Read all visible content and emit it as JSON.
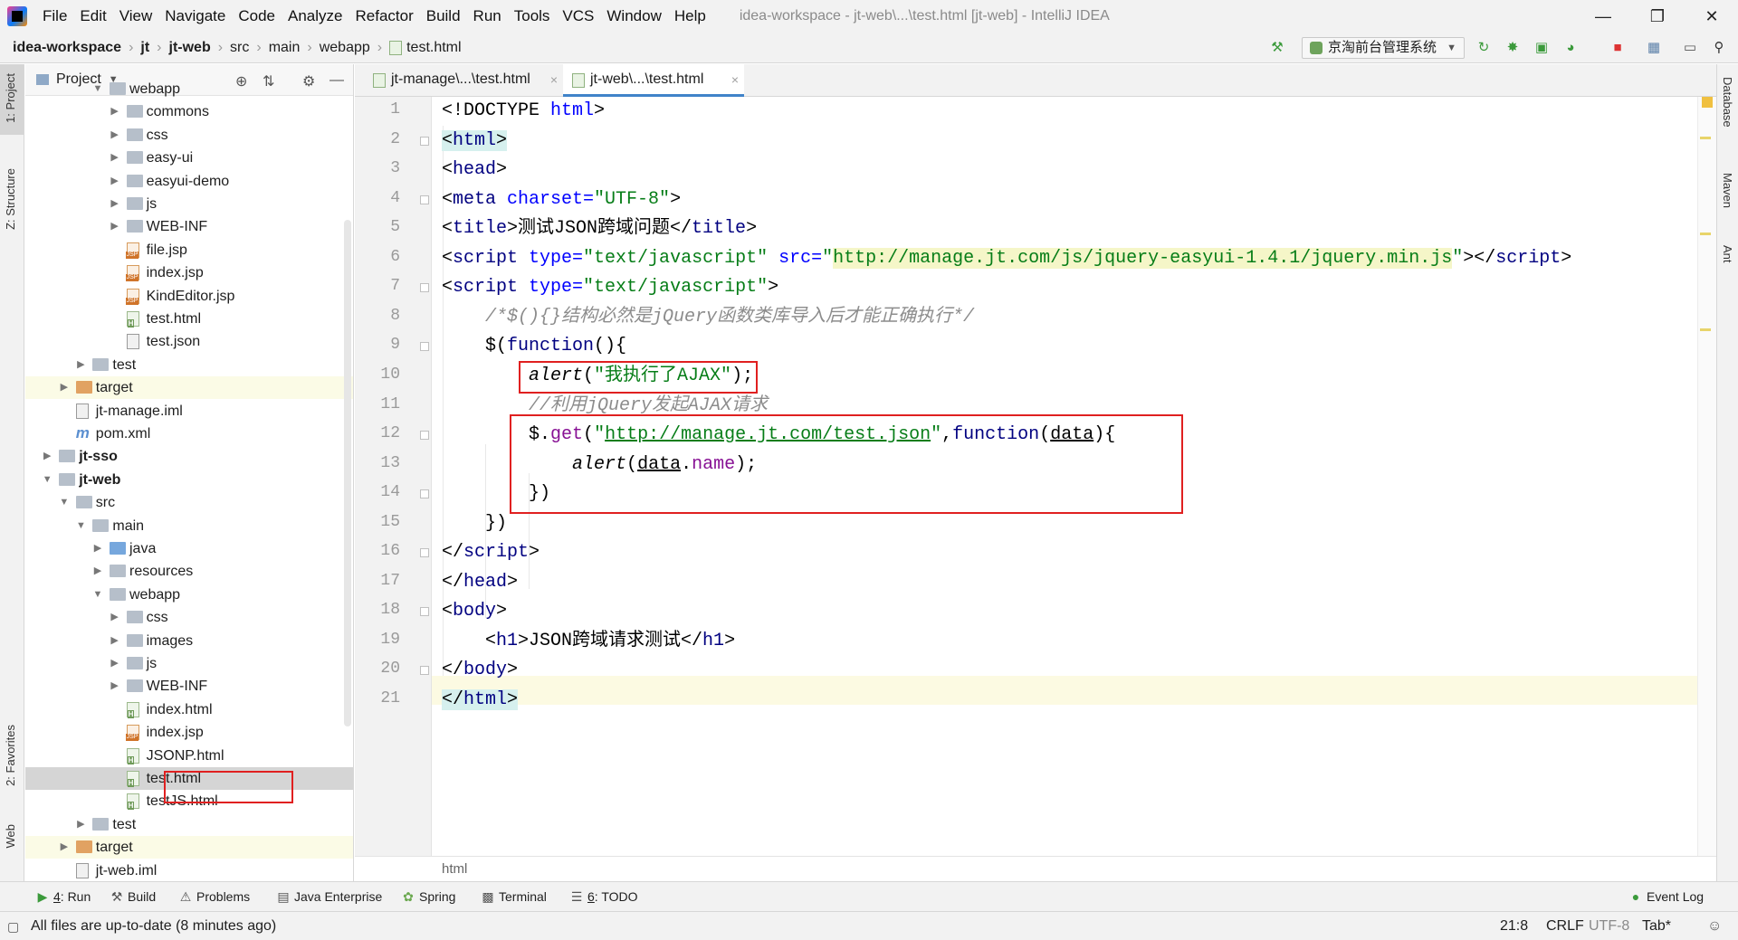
{
  "menu": {
    "items": [
      "File",
      "Edit",
      "View",
      "Navigate",
      "Code",
      "Analyze",
      "Refactor",
      "Build",
      "Run",
      "Tools",
      "VCS",
      "Window",
      "Help"
    ],
    "window_title": "idea-workspace - jt-web\\...\\test.html [jt-web] - IntelliJ IDEA"
  },
  "nav": {
    "crumbs": [
      "idea-workspace",
      "jt",
      "jt-web",
      "src",
      "main",
      "webapp",
      "test.html"
    ],
    "run_config": "京淘前台管理系统"
  },
  "stripes": {
    "left": [
      "1: Project",
      "Z: Structure",
      "2: Favorites",
      "Web"
    ],
    "right": [
      "Database",
      "Maven",
      "Ant"
    ]
  },
  "project": {
    "title": "Project",
    "tree": [
      {
        "label": "webapp",
        "icon": "folder-web",
        "arrow": "down",
        "indent": 5
      },
      {
        "label": "commons",
        "icon": "folder",
        "arrow": "right",
        "indent": 6
      },
      {
        "label": "css",
        "icon": "folder",
        "arrow": "right",
        "indent": 6
      },
      {
        "label": "easy-ui",
        "icon": "folder",
        "arrow": "right",
        "indent": 6
      },
      {
        "label": "easyui-demo",
        "icon": "folder",
        "arrow": "right",
        "indent": 6
      },
      {
        "label": "js",
        "icon": "folder",
        "arrow": "right",
        "indent": 6
      },
      {
        "label": "WEB-INF",
        "icon": "folder",
        "arrow": "right",
        "indent": 6
      },
      {
        "label": "file.jsp",
        "icon": "jsp",
        "arrow": "",
        "indent": 6
      },
      {
        "label": "index.jsp",
        "icon": "jsp",
        "arrow": "",
        "indent": 6
      },
      {
        "label": "KindEditor.jsp",
        "icon": "jsp",
        "arrow": "",
        "indent": 6
      },
      {
        "label": "test.html",
        "icon": "html",
        "arrow": "",
        "indent": 6
      },
      {
        "label": "test.json",
        "icon": "json",
        "arrow": "",
        "indent": 6
      },
      {
        "label": "test",
        "icon": "folder",
        "arrow": "right",
        "indent": 4
      },
      {
        "label": "target",
        "icon": "folder-orange",
        "arrow": "right",
        "indent": 3,
        "highlight": true
      },
      {
        "label": "jt-manage.iml",
        "icon": "iml",
        "arrow": "",
        "indent": 3
      },
      {
        "label": "pom.xml",
        "icon": "pom",
        "arrow": "",
        "indent": 3
      },
      {
        "label": "jt-sso",
        "icon": "module",
        "arrow": "right",
        "indent": 2,
        "module": true
      },
      {
        "label": "jt-web",
        "icon": "module",
        "arrow": "down",
        "indent": 2,
        "module": true
      },
      {
        "label": "src",
        "icon": "folder",
        "arrow": "down",
        "indent": 3
      },
      {
        "label": "main",
        "icon": "folder",
        "arrow": "down",
        "indent": 4
      },
      {
        "label": "java",
        "icon": "folder-blue",
        "arrow": "right",
        "indent": 5
      },
      {
        "label": "resources",
        "icon": "folder",
        "arrow": "right",
        "indent": 5
      },
      {
        "label": "webapp",
        "icon": "folder-web",
        "arrow": "down",
        "indent": 5
      },
      {
        "label": "css",
        "icon": "folder",
        "arrow": "right",
        "indent": 6
      },
      {
        "label": "images",
        "icon": "folder",
        "arrow": "right",
        "indent": 6
      },
      {
        "label": "js",
        "icon": "folder",
        "arrow": "right",
        "indent": 6
      },
      {
        "label": "WEB-INF",
        "icon": "folder",
        "arrow": "right",
        "indent": 6
      },
      {
        "label": "index.html",
        "icon": "html",
        "arrow": "",
        "indent": 6
      },
      {
        "label": "index.jsp",
        "icon": "jsp",
        "arrow": "",
        "indent": 6
      },
      {
        "label": "JSONP.html",
        "icon": "html",
        "arrow": "",
        "indent": 6
      },
      {
        "label": "test.html",
        "icon": "html",
        "arrow": "",
        "indent": 6,
        "selected": true
      },
      {
        "label": "testJS.html",
        "icon": "html",
        "arrow": "",
        "indent": 6
      },
      {
        "label": "test",
        "icon": "folder",
        "arrow": "right",
        "indent": 4
      },
      {
        "label": "target",
        "icon": "folder-orange",
        "arrow": "right",
        "indent": 3,
        "highlight": true
      },
      {
        "label": "jt-web.iml",
        "icon": "iml",
        "arrow": "",
        "indent": 3
      }
    ]
  },
  "tabs": [
    {
      "label": "jt-manage\\...\\test.html",
      "active": false
    },
    {
      "label": "jt-web\\...\\test.html",
      "active": true
    }
  ],
  "editor": {
    "line_numbers": [
      "1",
      "2",
      "3",
      "4",
      "5",
      "6",
      "7",
      "8",
      "9",
      "10",
      "11",
      "12",
      "13",
      "14",
      "15",
      "16",
      "17",
      "18",
      "19",
      "20",
      "21"
    ],
    "current_line": 21,
    "lines": [
      [
        {
          "t": "<!DOCTYPE ",
          "c": ""
        },
        {
          "t": "html",
          "c": "attr"
        },
        {
          "t": ">",
          "c": ""
        }
      ],
      [
        {
          "t": "<",
          "c": "hl"
        },
        {
          "t": "html",
          "c": "hltag"
        },
        {
          "t": ">",
          "c": "hl"
        }
      ],
      [
        {
          "t": "<",
          "c": ""
        },
        {
          "t": "head",
          "c": "tag"
        },
        {
          "t": ">",
          "c": ""
        }
      ],
      [
        {
          "t": "<",
          "c": ""
        },
        {
          "t": "meta ",
          "c": "tag"
        },
        {
          "t": "charset=",
          "c": "attr"
        },
        {
          "t": "\"UTF-8\"",
          "c": "str"
        },
        {
          "t": ">",
          "c": ""
        }
      ],
      [
        {
          "t": "<",
          "c": ""
        },
        {
          "t": "title",
          "c": "tag"
        },
        {
          "t": ">测试JSON跨域问题</",
          "c": ""
        },
        {
          "t": "title",
          "c": "tag"
        },
        {
          "t": ">",
          "c": ""
        }
      ],
      [
        {
          "t": "<",
          "c": ""
        },
        {
          "t": "script ",
          "c": "tag"
        },
        {
          "t": "type=",
          "c": "attr"
        },
        {
          "t": "\"text/javascript\" ",
          "c": "str"
        },
        {
          "t": "src=",
          "c": "attr"
        },
        {
          "t": "\"",
          "c": "str"
        },
        {
          "t": "http://manage.jt.com/js/jquery-easyui-1.4.1/jquery.min.js",
          "c": "url"
        },
        {
          "t": "\"",
          "c": "str"
        },
        {
          "t": "></",
          "c": ""
        },
        {
          "t": "script",
          "c": "tag"
        },
        {
          "t": ">",
          "c": ""
        }
      ],
      [
        {
          "t": "<",
          "c": ""
        },
        {
          "t": "script ",
          "c": "tag"
        },
        {
          "t": "type=",
          "c": "attr"
        },
        {
          "t": "\"text/javascript\"",
          "c": "str"
        },
        {
          "t": ">",
          "c": ""
        }
      ],
      [
        {
          "t": "    ",
          "c": ""
        },
        {
          "t": "/*$(){}结构必然是jQuery函数类库导入后才能正确执行*/",
          "c": "cmt"
        }
      ],
      [
        {
          "t": "    $(",
          "c": ""
        },
        {
          "t": "function",
          "c": "kw"
        },
        {
          "t": "(){",
          "c": ""
        }
      ],
      [
        {
          "t": "        ",
          "c": ""
        },
        {
          "t": "alert",
          "c": "fn"
        },
        {
          "t": "(",
          "c": ""
        },
        {
          "t": "\"我执行了AJAX\"",
          "c": "str"
        },
        {
          "t": ");",
          "c": ""
        }
      ],
      [
        {
          "t": "        ",
          "c": ""
        },
        {
          "t": "//利用jQuery发起AJAX请求",
          "c": "cmt"
        }
      ],
      [
        {
          "t": "        $.",
          "c": ""
        },
        {
          "t": "get",
          "c": "prop"
        },
        {
          "t": "(",
          "c": ""
        },
        {
          "t": "\"",
          "c": "str"
        },
        {
          "t": "http://manage.jt.com/test.json",
          "c": "strurl"
        },
        {
          "t": "\"",
          "c": "str"
        },
        {
          "t": ",",
          "c": ""
        },
        {
          "t": "function",
          "c": "kw"
        },
        {
          "t": "(",
          "c": ""
        },
        {
          "t": "data",
          "c": "u"
        },
        {
          "t": "){",
          "c": ""
        }
      ],
      [
        {
          "t": "            ",
          "c": ""
        },
        {
          "t": "alert",
          "c": "fn"
        },
        {
          "t": "(",
          "c": ""
        },
        {
          "t": "data",
          "c": "u"
        },
        {
          "t": ".",
          "c": ""
        },
        {
          "t": "name",
          "c": "prop"
        },
        {
          "t": ");",
          "c": ""
        }
      ],
      [
        {
          "t": "        })",
          "c": ""
        }
      ],
      [
        {
          "t": "    })",
          "c": ""
        }
      ],
      [
        {
          "t": "</",
          "c": ""
        },
        {
          "t": "script",
          "c": "tag"
        },
        {
          "t": ">",
          "c": ""
        }
      ],
      [
        {
          "t": "</",
          "c": ""
        },
        {
          "t": "head",
          "c": "tag"
        },
        {
          "t": ">",
          "c": ""
        }
      ],
      [
        {
          "t": "<",
          "c": ""
        },
        {
          "t": "body",
          "c": "tag"
        },
        {
          "t": ">",
          "c": ""
        }
      ],
      [
        {
          "t": "    <",
          "c": ""
        },
        {
          "t": "h1",
          "c": "tag"
        },
        {
          "t": ">JSON跨域请求测试</",
          "c": ""
        },
        {
          "t": "h1",
          "c": "tag"
        },
        {
          "t": ">",
          "c": ""
        }
      ],
      [
        {
          "t": "</",
          "c": ""
        },
        {
          "t": "body",
          "c": "tag"
        },
        {
          "t": ">",
          "c": ""
        }
      ],
      [
        {
          "t": "</",
          "c": "hl"
        },
        {
          "t": "html",
          "c": "hltag"
        },
        {
          "t": ">",
          "c": "hl"
        }
      ]
    ],
    "breadcrumb": "html"
  },
  "bottom_tools": [
    {
      "num": "4",
      "label": ": Run",
      "icon": "run-icon"
    },
    {
      "num": "",
      "label": "Build",
      "icon": "build-icon"
    },
    {
      "num": "",
      "label": "Problems",
      "icon": "warning-icon"
    },
    {
      "num": "",
      "label": "Java Enterprise",
      "icon": "java-enterprise-icon"
    },
    {
      "num": "",
      "label": "Spring",
      "icon": "spring-icon"
    },
    {
      "num": "",
      "label": "Terminal",
      "icon": "terminal-icon"
    },
    {
      "num": "6",
      "label": ": TODO",
      "icon": "todo-icon"
    }
  ],
  "event_log": "Event Log",
  "status": {
    "message": "All files are up-to-date (8 minutes ago)",
    "position": "21:8",
    "line_sep": "CRLF",
    "encoding": "UTF-8",
    "indent": "Tab*"
  },
  "colors": {
    "accent": "#4083c9",
    "annotation_red": "#e02020",
    "current_line": "#fcfae2"
  }
}
